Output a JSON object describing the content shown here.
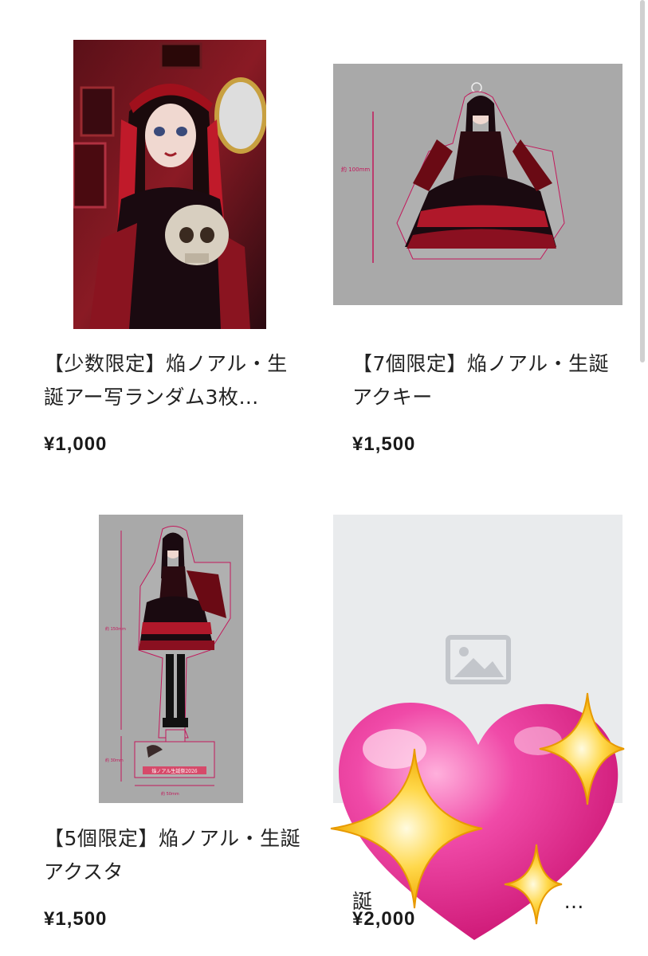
{
  "products": [
    {
      "title": "【少数限定】焔ノアル・生\n誕アー写ランダム3枚…",
      "price": "¥1,000",
      "image": "photo-gothic-girl-skull"
    },
    {
      "title": "【7個限定】焔ノアル・生誕\nアクキー",
      "price": "¥1,500",
      "image": "acrylic-keychain-preview",
      "dimension_label": "約 100mm"
    },
    {
      "title": "【5個限定】焔ノアル・生誕\nアクスタ",
      "price": "¥1,500",
      "image": "acrylic-stand-preview",
      "dimension_label": "約 150mm",
      "base_label": "約 30mm",
      "base_width_label": "約 50mm",
      "base_text": "焔ノアル生誕祭2026"
    },
    {
      "title": "誕",
      "title_tail": "…",
      "price": "¥2,000",
      "image": "placeholder-image-icon"
    }
  ],
  "overlay": {
    "icon": "sparkling-heart-emoji"
  },
  "colors": {
    "placeholder_bg": "#e9ebed",
    "placeholder_icon": "#c3c6cb",
    "mock_gray": "#a9a9a9",
    "cut_line": "#c2185b",
    "heart": "#e8258a"
  }
}
